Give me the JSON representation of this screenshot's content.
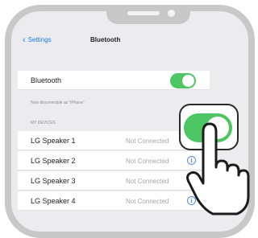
{
  "nav": {
    "back_label": "Settings",
    "title": "Bluetooth"
  },
  "bluetooth": {
    "label": "Bluetooth",
    "enabled": true,
    "discoverable_text": "Now discoverable as \"iPhone\""
  },
  "section_header": "MY DEVICES",
  "devices": [
    {
      "name": "LG Speaker 1",
      "status": "Not Connected"
    },
    {
      "name": "LG Speaker 2",
      "status": "Not Connected"
    },
    {
      "name": "LG Speaker 3",
      "status": "Not Connected"
    },
    {
      "name": "LG Speaker 4",
      "status": "Not Connected"
    }
  ],
  "colors": {
    "accent": "#1a7cf5",
    "toggle_on": "#4cc663",
    "phone_frame": "#c8c8c8"
  },
  "icons": {
    "back": "chevron-left-icon",
    "info": "info-icon",
    "hand": "pointing-hand-icon"
  }
}
